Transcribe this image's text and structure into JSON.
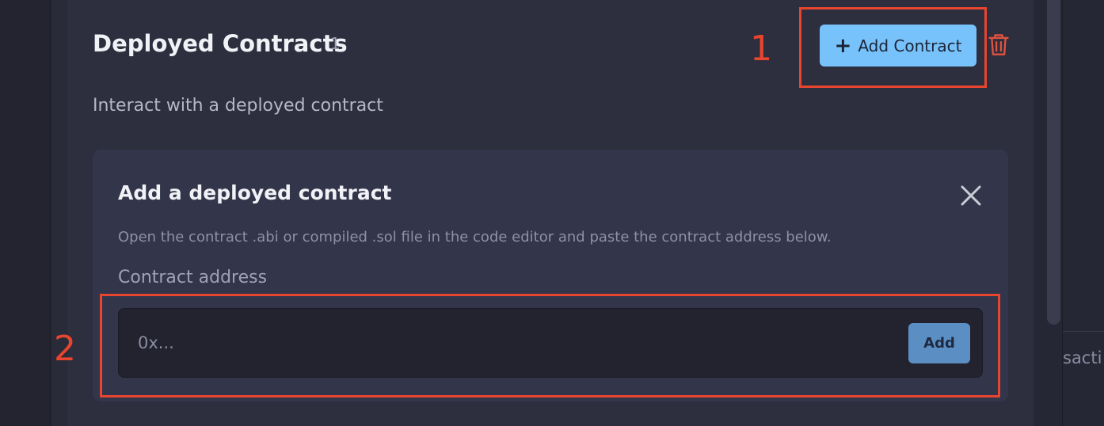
{
  "section": {
    "title": "Deployed Contracts",
    "count": "1",
    "description": "Interact with a deployed contract",
    "add_contract_label": "Add Contract",
    "add_contract_icon": "plus-icon",
    "delete_icon": "trash-icon"
  },
  "add_card": {
    "title": "Add a deployed contract",
    "close_icon": "close-icon",
    "help_text": "Open the contract .abi or compiled .sol file in the code editor and paste the contract address below.",
    "field_label": "Contract address",
    "address_value": "",
    "address_placeholder": "0x...",
    "add_button_label": "Add"
  },
  "right_panel": {
    "clipped_text": "sacti"
  },
  "annotations": {
    "marker_1": "1",
    "marker_2": "2",
    "color": "#e8452f"
  },
  "colors": {
    "accent_button": "#78c2fb",
    "add_button": "#5b8fc4",
    "delete_icon": "#e0533f",
    "panel_bg": "#2d2e3e",
    "card_bg": "#33354a"
  }
}
